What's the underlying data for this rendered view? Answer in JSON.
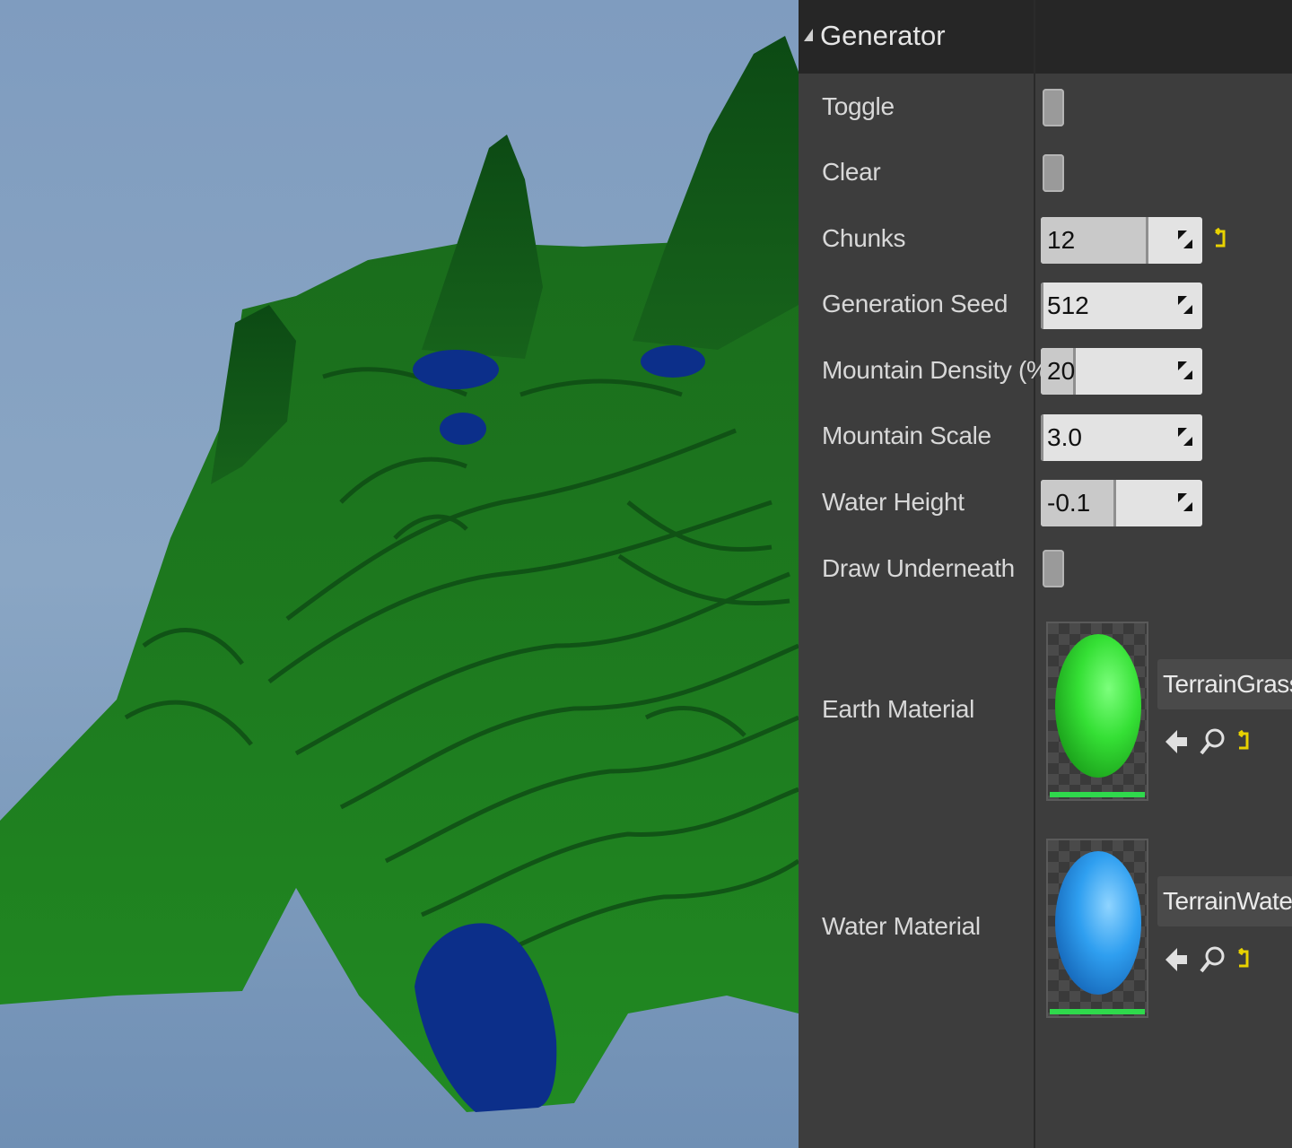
{
  "panel": {
    "header": {
      "title": "Generator"
    },
    "rows": [
      {
        "label": "Toggle"
      },
      {
        "label": "Clear"
      },
      {
        "label": "Chunks",
        "value": "12",
        "fill": 0.65
      },
      {
        "label": "Generation Seed",
        "value": "512",
        "fill": 0.0
      },
      {
        "label": "Mountain Density (%)",
        "value": "20",
        "fill": 0.2
      },
      {
        "label": "Mountain Scale",
        "value": "3.0",
        "fill": 0.0
      },
      {
        "label": "Water Height",
        "value": "-0.1",
        "fill": 0.45
      },
      {
        "label": "Draw Underneath"
      }
    ],
    "earth_material": {
      "label": "Earth Material",
      "asset": "TerrainGrass"
    },
    "water_material": {
      "label": "Water Material",
      "asset": "TerrainWater"
    }
  },
  "colors": {
    "sky": "#8aa6c4",
    "terrain": "#1f7f1f",
    "terrain_dark": "#0f4f18",
    "water": "#0c2f8a",
    "panel_bg": "#3d3d3d",
    "header_bg": "#262626",
    "grass_sphere": "#38e038",
    "water_sphere": "#2f9ff0",
    "accent_yellow": "#e8d200"
  }
}
